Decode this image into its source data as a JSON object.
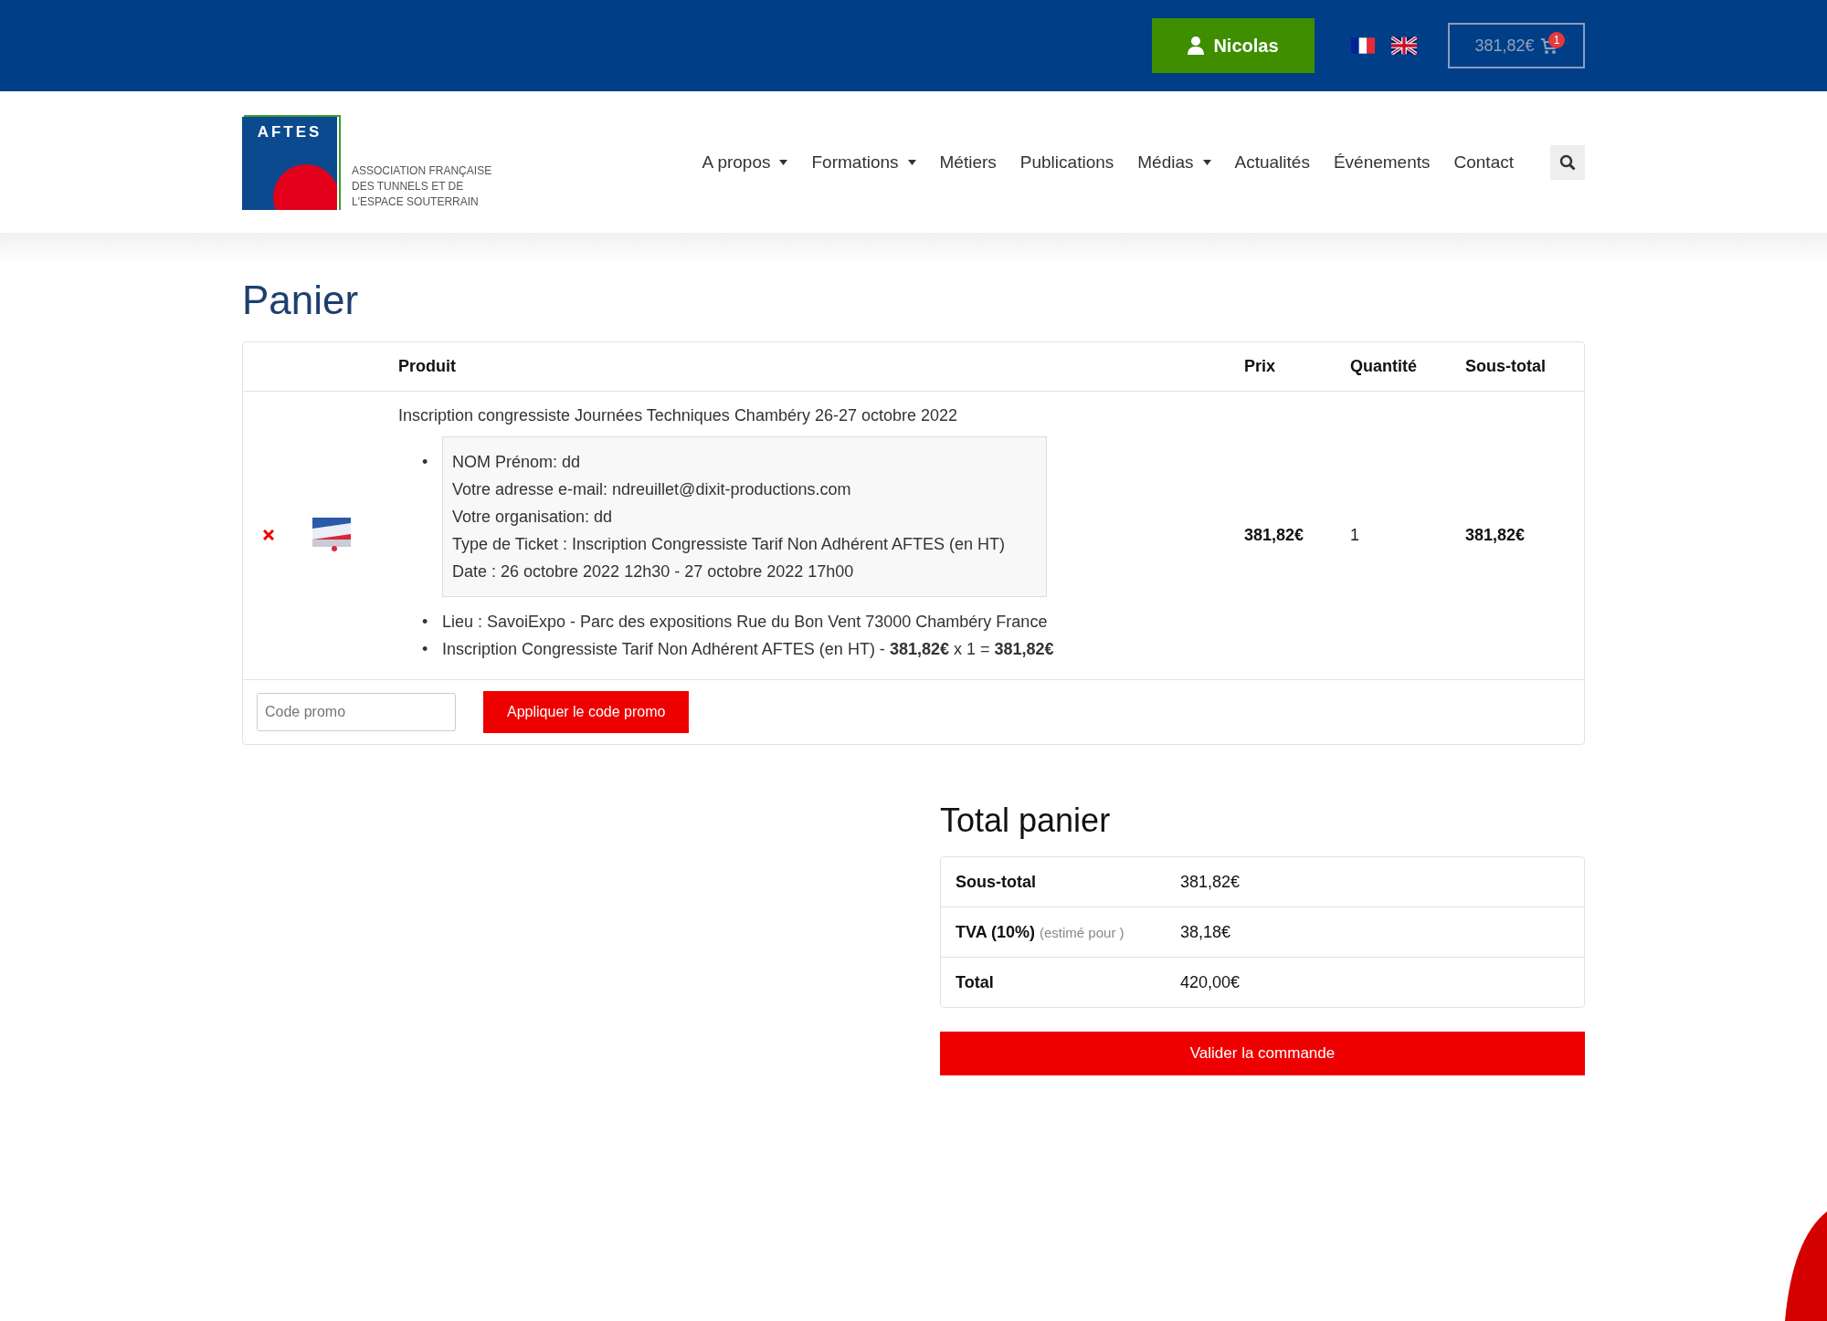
{
  "top_bar": {
    "user_button": "Nicolas",
    "languages": [
      {
        "kind": "fr"
      },
      {
        "kind": "en"
      }
    ],
    "cart": {
      "amount": "381,82€",
      "badge": "1"
    }
  },
  "logo": {
    "wordmark": "AFTES",
    "subtitle": [
      "ASSOCIATION FRANÇAISE",
      "DES TUNNELS ET DE",
      "L'ESPACE SOUTERRAIN"
    ]
  },
  "nav": [
    {
      "label": "A propos",
      "dropdown": true
    },
    {
      "label": "Formations",
      "dropdown": true
    },
    {
      "label": "Métiers",
      "dropdown": false
    },
    {
      "label": "Publications",
      "dropdown": false
    },
    {
      "label": "Médias",
      "dropdown": true
    },
    {
      "label": "Actualités",
      "dropdown": false
    },
    {
      "label": "Événements",
      "dropdown": false
    },
    {
      "label": "Contact",
      "dropdown": false
    }
  ],
  "page_title": "Panier",
  "cart_table": {
    "columns": [
      "Produit",
      "Prix",
      "Quantité",
      "Sous-total"
    ],
    "rows": [
      {
        "product": "Inscription congressiste Journées Techniques Chambéry 26-27 octobre 2022",
        "details_bullet": "•",
        "details": [
          "NOM Prénom: dd",
          "Votre adresse e-mail: ndreuillet@dixit-productions.com",
          "Votre organisation: dd",
          "Type de Ticket : Inscription Congressiste Tarif Non Adhérent AFTES (en HT)",
          "Date : 26 octobre 2022 12h30 - 27 octobre 2022 17h00"
        ],
        "meta": [
          {
            "bullet": "•",
            "text": "Lieu : SavoiExpo - Parc des expositions Rue du Bon Vent 73000 Chambéry France"
          },
          {
            "bullet": "•",
            "text": "Inscription Congressiste Tarif Non Adhérent AFTES (en HT) - **381,82€** x 1 = **381,82€**"
          }
        ],
        "price": "381,82€",
        "quantity": "1",
        "subtotal": "381,82€"
      }
    ],
    "promo": {
      "placeholder": "Code promo",
      "button": "Appliquer le code promo"
    }
  },
  "totals": {
    "title": "Total panier",
    "rows": [
      {
        "label": "Sous-total",
        "value": "381,82€"
      },
      {
        "label": "TVA (10%)",
        "note": "(estimé pour )",
        "value": "38,18€"
      },
      {
        "label": "Total",
        "value": "420,00€"
      }
    ],
    "checkout_button": "Valider la commande"
  }
}
